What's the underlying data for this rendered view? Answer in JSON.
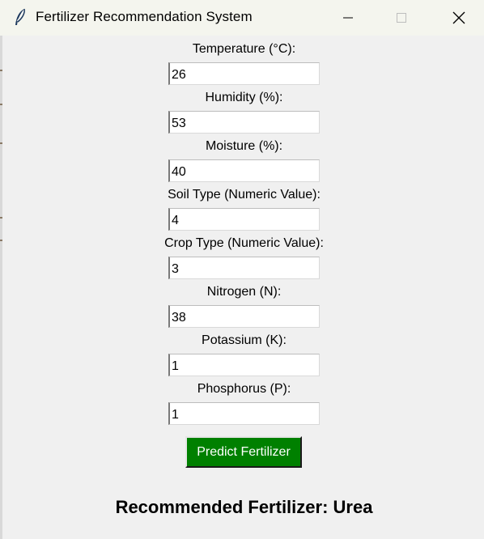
{
  "window": {
    "title": "Fertilizer Recommendation System",
    "icon": "feather-icon"
  },
  "fields": [
    {
      "label": "Temperature (°C):",
      "value": "26"
    },
    {
      "label": "Humidity (%):",
      "value": "53"
    },
    {
      "label": "Moisture (%):",
      "value": "40"
    },
    {
      "label": "Soil Type (Numeric Value):",
      "value": "4"
    },
    {
      "label": "Crop Type (Numeric Value):",
      "value": "3"
    },
    {
      "label": "Nitrogen (N):",
      "value": "38"
    },
    {
      "label": "Potassium (K):",
      "value": "1"
    },
    {
      "label": "Phosphorus (P):",
      "value": "1"
    }
  ],
  "predict_button": {
    "label": "Predict Fertilizer",
    "color": "#008000"
  },
  "result": {
    "text": "Recommended Fertilizer: Urea"
  }
}
